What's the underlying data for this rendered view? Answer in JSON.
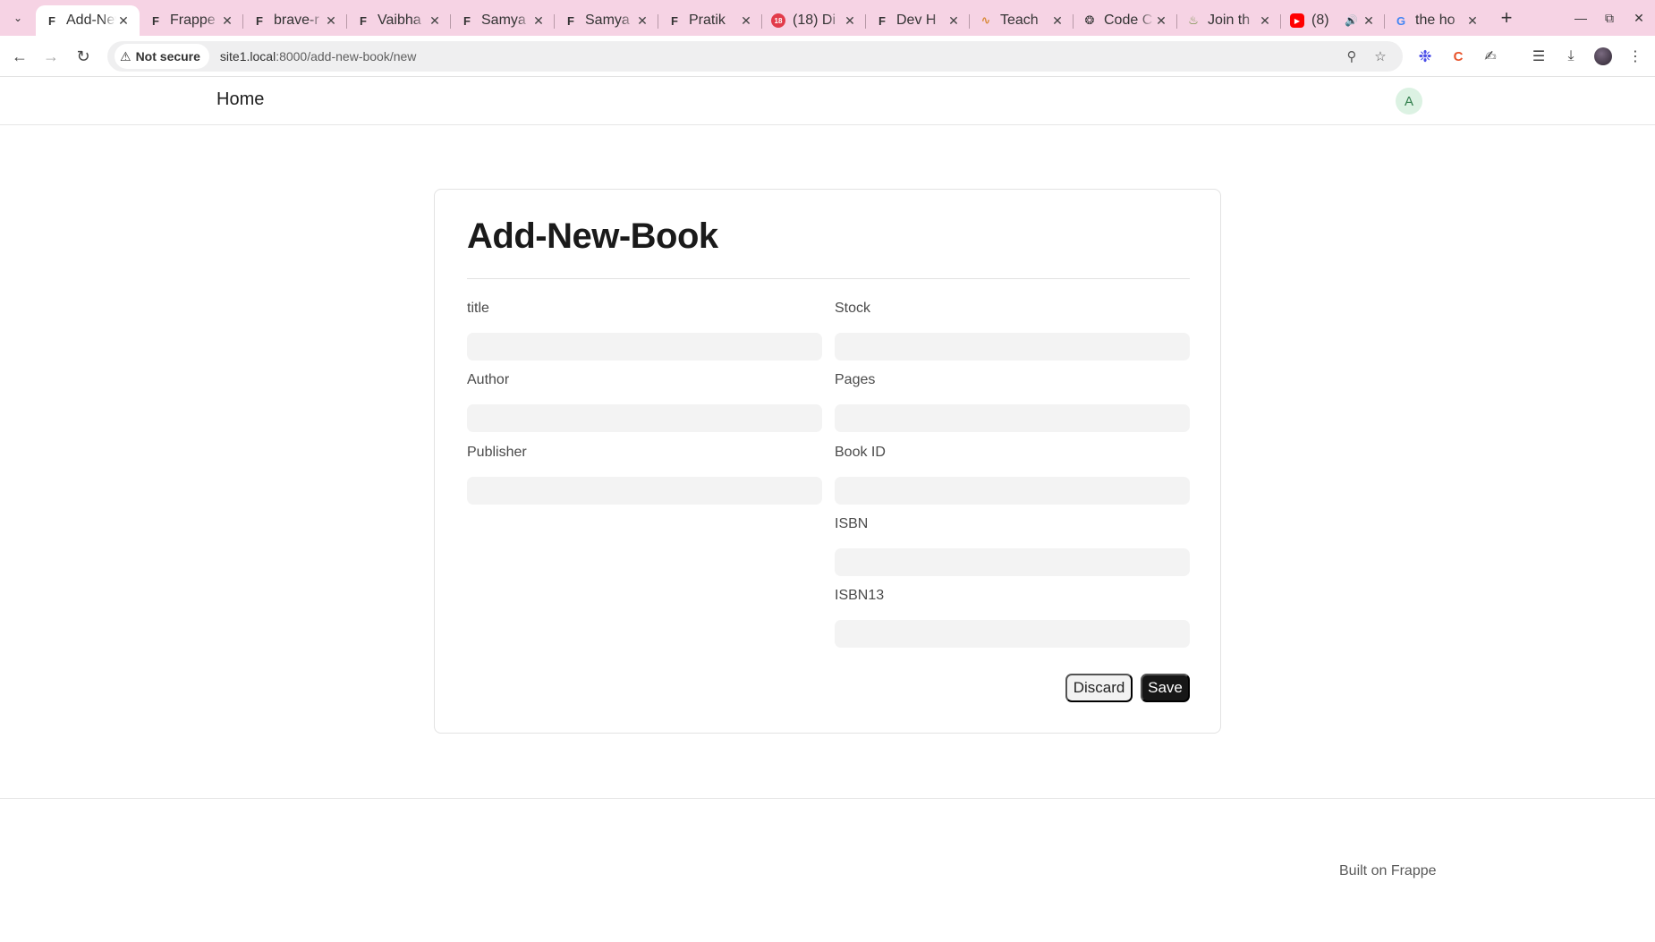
{
  "browser": {
    "tabs": [
      {
        "favicon": "frappe-icon",
        "title": "Add-New-Book",
        "active": true
      },
      {
        "favicon": "frappe-icon",
        "title": "Frappe",
        "active": false
      },
      {
        "favicon": "frappe-icon",
        "title": "brave-r",
        "active": false
      },
      {
        "favicon": "frappe-icon",
        "title": "Vaibha",
        "active": false
      },
      {
        "favicon": "frappe-icon",
        "title": "Samya",
        "active": false
      },
      {
        "favicon": "frappe-icon",
        "title": "Samya",
        "active": false
      },
      {
        "favicon": "frappe-icon",
        "title": "Pratik",
        "active": false
      },
      {
        "favicon": "discord-icon",
        "title": "(18) Di",
        "active": false
      },
      {
        "favicon": "frappe-icon",
        "title": "Dev H",
        "active": false
      },
      {
        "favicon": "teach-icon",
        "title": "Teach",
        "active": false
      },
      {
        "favicon": "openai-icon",
        "title": "Code C",
        "active": false
      },
      {
        "favicon": "join-icon",
        "title": "Join th",
        "active": false
      },
      {
        "favicon": "youtube-icon",
        "title": "(8)",
        "active": false
      },
      {
        "favicon": "google-icon",
        "title": "the ho",
        "active": false
      }
    ],
    "security_label": "Not secure",
    "url_host": "site1.local",
    "url_path": ":8000/add-new-book/new"
  },
  "site": {
    "home_label": "Home",
    "avatar_letter": "A"
  },
  "form": {
    "heading": "Add-New-Book",
    "left_fields": [
      {
        "label": "title",
        "value": ""
      },
      {
        "label": "Author",
        "value": ""
      },
      {
        "label": "Publisher",
        "value": ""
      }
    ],
    "right_fields": [
      {
        "label": "Stock",
        "value": ""
      },
      {
        "label": "Pages",
        "value": ""
      },
      {
        "label": "Book ID",
        "value": ""
      },
      {
        "label": "ISBN",
        "value": ""
      },
      {
        "label": "ISBN13",
        "value": ""
      }
    ],
    "discard_label": "Discard",
    "save_label": "Save"
  },
  "footer": {
    "text": "Built on Frappe"
  },
  "colors": {
    "tabstrip": "#f6d3e4",
    "save_button": "#171717",
    "avatar_bg": "#dcf2e3"
  }
}
